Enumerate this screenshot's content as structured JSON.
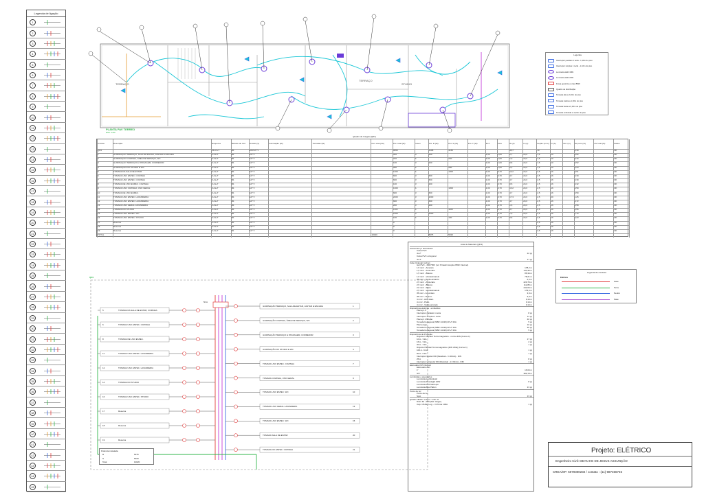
{
  "left_legend": {
    "title": "Legenda de ligação",
    "numbers": [
      "1",
      "2",
      "3",
      "4",
      "5",
      "6",
      "7",
      "8",
      "9",
      "10",
      "11",
      "12",
      "13",
      "14",
      "15",
      "16",
      "17",
      "18",
      "19",
      "20",
      "21",
      "22",
      "23",
      "24",
      "25",
      "26",
      "27",
      "28",
      "29",
      "30",
      "31",
      "32",
      "33",
      "34",
      "35",
      "36",
      "37",
      "38",
      "39",
      "40",
      "41",
      "42",
      "43",
      "44",
      "45"
    ]
  },
  "floor_plan": {
    "label_terraco_left": "TERRAÇO",
    "label_terraco_mid": "TERRAÇO",
    "label_studio": "STUDIO",
    "label_plan": "PLANTA PAV TERREO",
    "scale": "ESC: 1/50"
  },
  "top_legend": {
    "title": "Legenda",
    "items": [
      "Interruptor paralelo 1 tecla - 1,10m do piso",
      "Interruptor simples 1 tecla - 1,10m do piso",
      "Luminária LED 18W",
      "Luminária LED 24W",
      "Força genérica ou tipo BWF",
      "Quadro de distribuição",
      "Tomada alta a 2,20m do piso",
      "Tomada média a 1,30m do piso",
      "Tomada baixa a 0,30m do piso",
      "Tomada embutida a 1,10m do piso"
    ]
  },
  "load_table": {
    "title": "Quadro de Cargas (QD1)",
    "headers": [
      "Circuito",
      "Descrição",
      "Esquema",
      "Método de Inst.",
      "Tensão (V)",
      "Iluminação (W)",
      "Tomadas (W)",
      "Pot. total (VA)",
      "Pot. total (W)",
      "Fases",
      "Pot. R (W)",
      "Pot. S (W)",
      "Pot. T (W)",
      "FCT",
      "FCA",
      "Ib (A)",
      "Iz (A)",
      "Seção (mm²)",
      "In (A)",
      "Dist. (m)",
      "ΔV parc (%)",
      "ΔV total (%)",
      "Status"
    ],
    "rows": [
      [
        "QD1",
        "",
        "3F+N+T",
        "B1",
        "220/127 V",
        "",
        "",
        "",
        "9950",
        "",
        "4108",
        "4166",
        "",
        "",
        "",
        "36,7",
        "",
        "10",
        "",
        "",
        "0,30",
        "",
        "OK"
      ],
      [
        "1",
        "ILUMINAÇÃO TERRAÇO, SALA DE ESTAR, JANTAR E ESCADA",
        "F+N+T",
        "B1",
        "127 V",
        "",
        "",
        "",
        "340",
        "R",
        "340",
        "",
        "",
        "1,00",
        "1,00",
        "2,7",
        "24,0",
        "1,5",
        "10",
        "",
        "0,52",
        "",
        "OK"
      ],
      [
        "2",
        "ILUMINAÇÃO COZINHA, ÁREA DE SERVIÇO, WC",
        "F+N+T",
        "B1",
        "127 V",
        "",
        "",
        "",
        "240",
        "S",
        "",
        "240",
        "",
        "1,00",
        "1,00",
        "1,9",
        "24,0",
        "1,5",
        "10",
        "",
        "0,44",
        "",
        "OK"
      ],
      [
        "3",
        "ILUMINAÇÃO TERRAÇO E PASSAGEM, CORREDOR",
        "F+N+T",
        "B1",
        "127 V",
        "",
        "",
        "",
        "100",
        "R",
        "100",
        "",
        "",
        "1,00",
        "1,00",
        "0,8",
        "24,0",
        "1,5",
        "10",
        "",
        "0,52",
        "",
        "OK"
      ],
      [
        "4",
        "ILUMINAÇÃO DO STUDIO E WC",
        "F+N+T",
        "B1",
        "127 V",
        "",
        "",
        "",
        "280",
        "S",
        "",
        "280",
        "",
        "1,00",
        "1,00",
        "2,2",
        "24,0",
        "1,5",
        "10",
        "",
        "0,23",
        "",
        "OK"
      ],
      [
        "5",
        "TOMADA DA SALA DE ESTAR",
        "F+N+T",
        "B1",
        "127 V",
        "",
        "",
        "",
        "1300",
        "S",
        "",
        "1300",
        "",
        "1,00",
        "0,70",
        "10,2",
        "24,0",
        "2,5",
        "16",
        "",
        "0,51",
        "",
        "OK"
      ],
      [
        "6",
        "TOMADA USO ESPEC. COZINHA",
        "F+N+T",
        "B1",
        "127 V",
        "",
        "",
        "",
        "600",
        "R",
        "600",
        "",
        "",
        "1,00",
        "0,70",
        "4,7",
        "24,0",
        "2,5",
        "16",
        "",
        "0,39",
        "",
        "OK"
      ],
      [
        "7",
        "TOMADA USO ESPEC. COZINHA",
        "F+N+T",
        "B1",
        "127 V",
        "",
        "",
        "",
        "600",
        "R",
        "600",
        "",
        "",
        "1,00",
        "0,70",
        "4,7",
        "24,0",
        "2,5",
        "16",
        "",
        "0,39",
        "",
        "OK"
      ],
      [
        "8",
        "TOMADA DE USO ESPEC. COZINHA",
        "F+N+T",
        "B1",
        "127 V",
        "",
        "",
        "",
        "100",
        "R",
        "100",
        "",
        "",
        "1,00",
        "0,70",
        "0,8",
        "24,0",
        "2,5",
        "16",
        "",
        "0,32",
        "",
        "OK"
      ],
      [
        "9",
        "TOMADA USO COZINHA, USO GERAL",
        "F+N+T",
        "B1",
        "127 V",
        "",
        "",
        "",
        "1300",
        "S",
        "",
        "1300",
        "",
        "1,00",
        "0,70",
        "10,2",
        "24,0",
        "2,5",
        "16",
        "",
        "0,59",
        "",
        "OK"
      ],
      [
        "10",
        "TOMADA DE USO ESPEC.",
        "F+N+T",
        "B1",
        "127 V",
        "",
        "",
        "",
        "600",
        "R",
        "600",
        "",
        "",
        "1,00",
        "0,70",
        "4,7",
        "24,0",
        "2,5",
        "16",
        "",
        "0,59",
        "",
        "OK"
      ],
      [
        "11",
        "TOMADA USO ESPEC. LAVANDERIA",
        "F+N+T",
        "B1",
        "127 V",
        "",
        "",
        "",
        "2200",
        "R",
        "2200",
        "",
        "",
        "1,00",
        "0,70",
        "17,3",
        "24,0",
        "2,5",
        "20",
        "",
        "1,25",
        "",
        "OK"
      ],
      [
        "12",
        "TOMADA USO ESPEC. LAVANDERIA",
        "F+N+T",
        "B1",
        "127 V",
        "",
        "",
        "",
        "600",
        "R",
        "600",
        "",
        "",
        "1,00",
        "0,70",
        "4,7",
        "24,0",
        "2,5",
        "16",
        "",
        "0,72",
        "",
        "OK"
      ],
      [
        "13",
        "TOMADA USO GERAL LAVANDERIA",
        "F+N+T",
        "B1",
        "127 V",
        "",
        "",
        "",
        "200",
        "R",
        "200",
        "",
        "",
        "1,00",
        "0,70",
        "1,6",
        "24,0",
        "2,5",
        "16",
        "",
        "0,58",
        "",
        "OK"
      ],
      [
        "14",
        "TOMADA DO STUDIO",
        "F+N+T",
        "B1",
        "127 V",
        "",
        "",
        "",
        "1100",
        "S",
        "",
        "1100",
        "",
        "1,00",
        "0,70",
        "8,7",
        "24,0",
        "2,5",
        "16",
        "",
        "0,55",
        "",
        "OK"
      ],
      [
        "15",
        "TOMADA USO ESPEC. WC",
        "F+N+T",
        "B1",
        "127 V",
        "",
        "",
        "",
        "1000",
        "R",
        "1000",
        "",
        "",
        "1,00",
        "0,70",
        "7,9",
        "24,0",
        "2,5",
        "16",
        "",
        "1,14",
        "",
        "OK"
      ],
      [
        "16",
        "TOMADA USO ESPEC. STUDIO",
        "F+N+T",
        "B1",
        "127 V",
        "",
        "",
        "",
        "100",
        "S",
        "",
        "100",
        "",
        "1,00",
        "0,70",
        "0,8",
        "24,0",
        "2,5",
        "16",
        "",
        "0,23",
        "",
        "OK"
      ],
      [
        "17",
        "Reserva",
        "F+N+T",
        "B1",
        "127 V",
        "",
        "",
        "",
        "0",
        "",
        "",
        "",
        "",
        "",
        "",
        "",
        "",
        "2,5",
        "16",
        "",
        "",
        "",
        "OK"
      ],
      [
        "18",
        "Reserva",
        "F+N+T",
        "B1",
        "127 V",
        "",
        "",
        "",
        "0",
        "",
        "",
        "",
        "",
        "",
        "",
        "",
        "",
        "2,5",
        "16",
        "",
        "",
        "",
        "OK"
      ],
      [
        "19",
        "Reserva",
        "F+N+T",
        "B1",
        "127 V",
        "",
        "",
        "",
        "0",
        "",
        "",
        "",
        "",
        "",
        "",
        "",
        "",
        "2,5",
        "16",
        "",
        "",
        "",
        "OK"
      ]
    ],
    "total_label": "TOTAL",
    "total_va": "10020",
    "total_r": "5075",
    "total_s": "5020"
  },
  "single_line": {
    "title": "QD1",
    "left_circuits": [
      {
        "num": "5",
        "label": "TOMADA DA SALA DE ESTAR, COZINHA"
      },
      {
        "num": "6",
        "label": "TOMADA USO ESPEC. COZINHA"
      },
      {
        "num": "8",
        "label": "TOMADA DE USO ESPEC."
      },
      {
        "num": "11",
        "label": "TOMADA USO ESPEC. LAVANDERIA"
      },
      {
        "num": "12",
        "label": "TOMADA USO ESPEC. LAVANDERIA"
      },
      {
        "num": "14",
        "label": "TOMADA DO STUDIO"
      },
      {
        "num": "16",
        "label": "TOMADA USO ESPEC. STUDIO"
      },
      {
        "num": "17",
        "label": "Reserva"
      },
      {
        "num": "18",
        "label": "Reserva"
      },
      {
        "num": "19",
        "label": "Reserva"
      }
    ],
    "right_circuits": [
      {
        "num": "1",
        "label": "ILUMINAÇÃO TERRAÇO, SALA DE ESTAR, JANTAR E ESCADA"
      },
      {
        "num": "2",
        "label": "ILUMINAÇÃO COZINHA, ÁREA DE SERVIÇO, WC"
      },
      {
        "num": "3",
        "label": "ILUMINAÇÃO TERRAÇO E PASSAGEM, CORREDOR"
      },
      {
        "num": "4",
        "label": "ILUMINAÇÃO DO STUDIO E WC"
      },
      {
        "num": "7",
        "label": "TOMADA USO ESPEC. COZINHA"
      },
      {
        "num": "9",
        "label": "TOMADA COZINHA, USO GERAL"
      },
      {
        "num": "10",
        "label": "TOMADA USO ESPEC. WC"
      },
      {
        "num": "13",
        "label": "TOMADA USO GERAL LAVANDERIA"
      },
      {
        "num": "15",
        "label": "TOMADA USO ESPEC. WC"
      },
      {
        "num": "20",
        "label": "TOMADA SALA DE ESTAR"
      },
      {
        "num": "21",
        "label": "TOMADA DO ESPEC. COZINHA"
      }
    ],
    "main_breaker": "50 A",
    "legend_label": "Potência instalada",
    "legend_rows": [
      [
        "R",
        "5075"
      ],
      [
        "S",
        "5020"
      ],
      [
        "Total",
        "10020"
      ]
    ]
  },
  "materials": {
    "title": "Lista de Materiais (QD1)",
    "sections": [
      {
        "header": "Acessórios p/ eletrodutos",
        "items": [
          [
            "Caixa PVC",
            ""
          ],
          [
            "4x 2\"",
            "22 pç"
          ],
          [
            "Caixa PVC octogonal",
            ""
          ],
          [
            "4x 4\"",
            "17 pç"
          ]
        ]
      },
      {
        "header": "Cabo Unipolar (cobre)",
        "items": [
          [
            "Isol PVC - 450/750V (ref. Pirastic Ecoplus BWF Flexível)",
            ""
          ],
          [
            "1,5 mm² - Amarelo",
            "178,2 m"
          ],
          [
            "1,5 mm² - Azul-claro",
            "143,35 m"
          ],
          [
            "1,5 mm² - Branco",
            "86,34 m"
          ],
          [
            "1,5 mm² - Verde/amarelo",
            "78,21 m"
          ],
          [
            "35 mm² - Verde-amarelo",
            "2,6 m"
          ],
          [
            "2,5 mm² - Azul-claro",
            "229,79 m"
          ],
          [
            "2,5 mm² - Branco",
            "112,86 m"
          ],
          [
            "2,5 mm² - Preto",
            "243,64 m"
          ],
          [
            "2,5 mm² - Verde/amarelo",
            "179,6 m"
          ],
          [
            "35 mm² - Azul-claro",
            "3,9 m"
          ],
          [
            "35 mm² - Branco",
            "3,9 m"
          ],
          [
            "4 mm² - Azul-claro",
            "0,14 m"
          ],
          [
            "4 mm² - Preto",
            "0,14 m"
          ],
          [
            "4 mm² - Verde-amarelo",
            "0,14 m"
          ]
        ]
      },
      {
        "header": "Dispositivos elétricos - embutidos",
        "items": [
          [
            "Placa p/ 4\"",
            ""
          ],
          [
            "Interruptor paralelo 1 tecla",
            "8 pç"
          ],
          [
            "Interruptor simples 1 tecla",
            "11 pç"
          ],
          [
            "Placa p/ 1 função",
            "40 pç"
          ],
          [
            "Tomada hexagonal (NBR 14136) 2P+T 20A",
            "5 pç"
          ],
          [
            "Placa cega",
            "10 pç"
          ],
          [
            "Tomada hexagonal (NBR 14136) 2P+T 10A",
            "30 pç"
          ],
          [
            "Tomada hexagonal (NBR 14136) 2P+T 20A",
            "5 pç"
          ]
        ]
      },
      {
        "header": "Dispositivos de Proteção",
        "items": [
          [
            "Disjuntor Unipolar Termomagnético - norma DIN (Curva C)",
            ""
          ],
          [
            "10 A - 3 kA",
            "17 pç"
          ],
          [
            "16 A - 3 kA",
            "2 pç"
          ],
          [
            "20 A - 3 kA",
            "1 pç"
          ],
          [
            "Disjuntor Bipolar Termomagnético (DIN VDE) (Curva C)",
            ""
          ],
          [
            "100 A - 6 kA",
            "1 pç"
          ],
          [
            "50 A - 6 kA",
            "1 pç"
          ],
          [
            "Interruptor bipolar DR (Residual - In 30mA) - DIN",
            ""
          ],
          [
            "25 A",
            "8 pç"
          ],
          [
            "Interruptor tetrapolar DR (Residual - In 30mA) - DIN",
            "1 pç"
          ]
        ]
      },
      {
        "header": "Eletroduto PVC flexível",
        "items": [
          [
            "Eletroduto corr.",
            ""
          ],
          [
            "1\"",
            "16,04 m"
          ],
          [
            "3/4\"",
            "389,78 m"
          ]
        ]
      },
      {
        "header": "Luminárias e acessórios",
        "items": [
          [
            "Luminária Led Embutir",
            ""
          ],
          [
            "Luminária Downlight 20W",
            "8 pç"
          ],
          [
            "Luminária Led Sobrepor",
            ""
          ],
          [
            "Luminária Box Plafon",
            "13 pç"
          ]
        ]
      },
      {
        "header": "Ponto de luz",
        "items": [
          [
            "Ponto de luz",
            ""
          ],
          [
            "Spot",
            "13 pç"
          ]
        ]
      },
      {
        "header": "Quadro distrib. embut. / emb. bf",
        "items": [
          [
            "Distr. 60 - DIN (Ref. Hager)",
            ""
          ],
          [
            "Cap. 18 disj. Leg. - In Ponte 100A",
            "1 pç"
          ]
        ]
      }
    ]
  },
  "conductor_legend": {
    "title": "Legenda de condutor",
    "subtitle": "Elétrica",
    "items": [
      {
        "label": "Fase",
        "color": "#e23b3b"
      },
      {
        "label": "Terra",
        "color": "#2fb54a"
      },
      {
        "label": "Neutro",
        "color": "#3b6be2"
      },
      {
        "label": "Fase",
        "color": "#b35ad6"
      }
    ]
  },
  "title_block": {
    "project": "Projeto: ELÉTRICO",
    "engineer": "Engenheiro Civil: DEAN HE DE JESUS ASSUNÇÃO",
    "crea": "CREA/SP: 5070300232 / contato : (11) 987456745"
  },
  "colors": {
    "cyan": "#18c6d6",
    "violet": "#6a3bd8",
    "orange": "#e59a2a",
    "red": "#e23b3b",
    "green": "#2fb54a",
    "magenta": "#c43bd8",
    "blue": "#3b6be2"
  }
}
